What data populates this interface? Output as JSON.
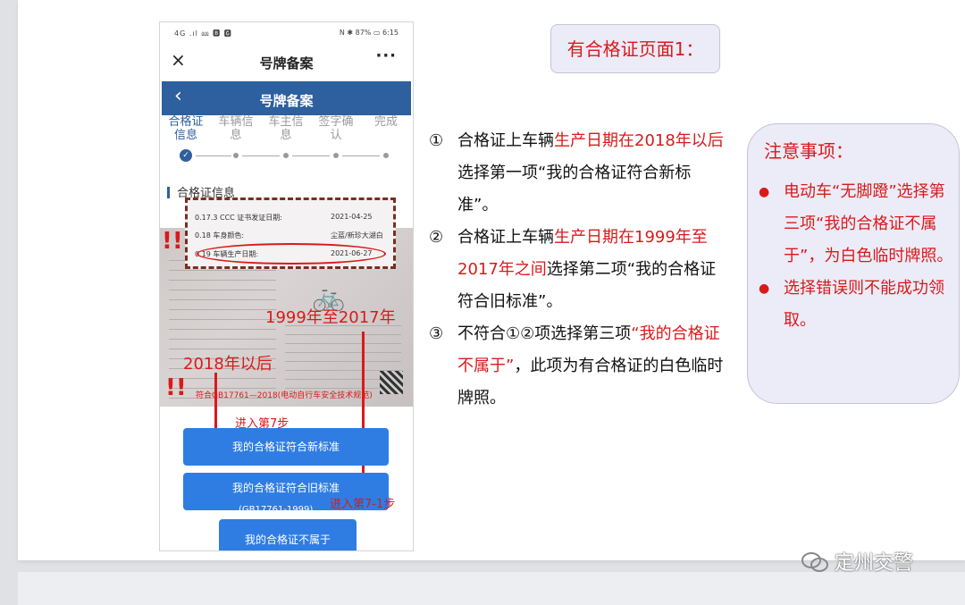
{
  "phone": {
    "status_left": "4G .ıl ⅏ 🅱 🅶",
    "status_right": "N ✱ 87% ▭ 6:15",
    "topbar_title": "号牌备案",
    "close_glyph": "×",
    "more_glyph": "···",
    "page_title": "号牌备案",
    "back_glyph": "‹",
    "steps": [
      {
        "label": "合格证信息",
        "l1": "合格证",
        "l2": "信息"
      },
      {
        "label": "车辆信息",
        "l1": "车辆信",
        "l2": "息"
      },
      {
        "label": "车主信息",
        "l1": "车主信",
        "l2": "息"
      },
      {
        "label": "签字确认",
        "l1": "签字确",
        "l2": "认"
      },
      {
        "label": "完成",
        "l1": "完成",
        "l2": ""
      }
    ],
    "section_title": "合格证信息",
    "cert_rows": [
      {
        "label": "0.17.3 CCC 证书发证日期:",
        "value": "2021-04-25"
      },
      {
        "label": "0.18 车身颜色:",
        "value": "尘蓝/新珍大湖白"
      },
      {
        "label": "0.19 车辆生产日期:",
        "value": "2021-06-27"
      }
    ],
    "standard_note": "符合GB17761—2018(电动自行车安全技术规范)",
    "annotation_1999": "1999年至2017年",
    "annotation_2018": "2018年以后",
    "step7": "进入第7步",
    "step7_1": "进入第7-1步",
    "buttons": {
      "new_standard": "我的合格证符合新标准",
      "old_standard": "我的合格证符合旧标准",
      "old_standard_sub": "(GB17761-1999)",
      "none": "我的合格证不属于"
    }
  },
  "heading": "有合格证页面1：",
  "items": [
    {
      "num": "①",
      "pre": "合格证上车辆",
      "red": "生产日期在2018年以后",
      "post": "选择第一项“我的合格证符合新标准”。"
    },
    {
      "num": "②",
      "pre": "合格证上车辆",
      "red": "生产日期在1999年至2017年之间",
      "post": "选择第二项“我的合格证符合旧标准”。"
    },
    {
      "num": "③",
      "pre": "不符合①②项选择第三项",
      "red": "“我的合格证不属于”",
      "post": "，此项为有合格证的白色临时牌照。"
    }
  ],
  "notes": {
    "title": "注意事项：",
    "items": [
      "电动车“无脚蹬”选择第三项“我的合格证不属于”，为白色临时牌照。",
      "选择错误则不能成功领取。"
    ]
  },
  "watermark": "定州交警",
  "colors": {
    "accent_red": "#d91a1a",
    "phone_blue": "#2e5f9e",
    "button_blue": "#2f7de3"
  }
}
